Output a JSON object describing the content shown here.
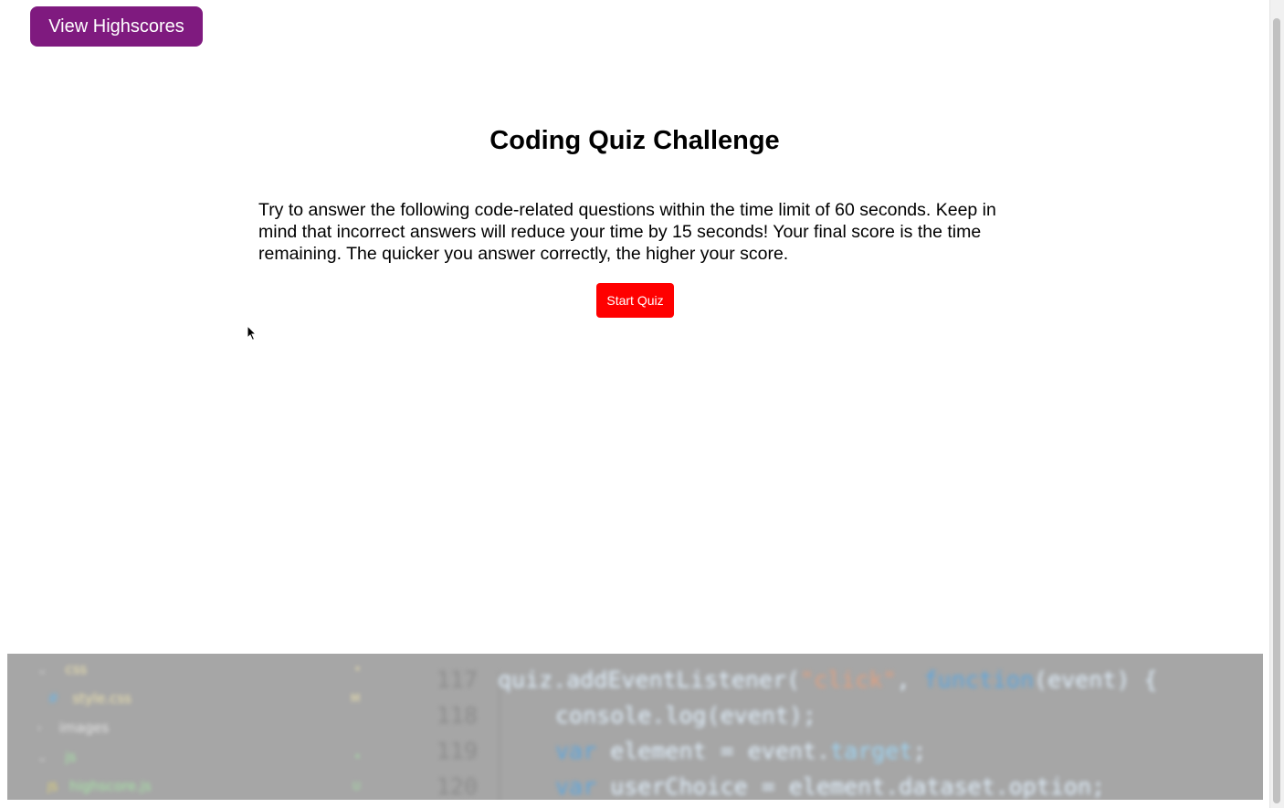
{
  "header": {
    "highscores_label": "View Highscores"
  },
  "main": {
    "title": "Coding Quiz Challenge",
    "intro": "Try to answer the following code-related questions within the time limit of 60 seconds. Keep in mind that incorrect answers will reduce your time by 15 seconds! Your final score is the time remaining. The quicker you answer correctly, the higher your score.",
    "start_label": "Start Quiz"
  },
  "background_editor": {
    "tree": [
      {
        "icon": "chevron-down-icon",
        "label": "css",
        "badge": "•"
      },
      {
        "icon": "css-file-icon",
        "label": "style.css",
        "badge": "M"
      },
      {
        "icon": "chevron-right-icon",
        "label": "images",
        "badge": ""
      },
      {
        "icon": "chevron-down-icon",
        "label": "js",
        "badge": "•"
      },
      {
        "icon": "js-file-icon",
        "label": "highscore.js",
        "badge": "U"
      }
    ],
    "line_numbers": [
      "117",
      "118",
      "119",
      "120"
    ],
    "code": {
      "l1_a": "quiz.addEventListener(",
      "l1_str": "\"click\"",
      "l1_b": ", ",
      "l1_kw": "function",
      "l1_c": "(event) {",
      "l2": "console.log(event);",
      "l3_kw": "var",
      "l3_a": " element = event.",
      "l3_prop": "target",
      "l3_b": ";",
      "l4_kw": "var",
      "l4_a": " userChoice = element.dataset.option;"
    }
  },
  "colors": {
    "highscores_button": "#7f1a7f",
    "start_button": "#ff0000"
  }
}
